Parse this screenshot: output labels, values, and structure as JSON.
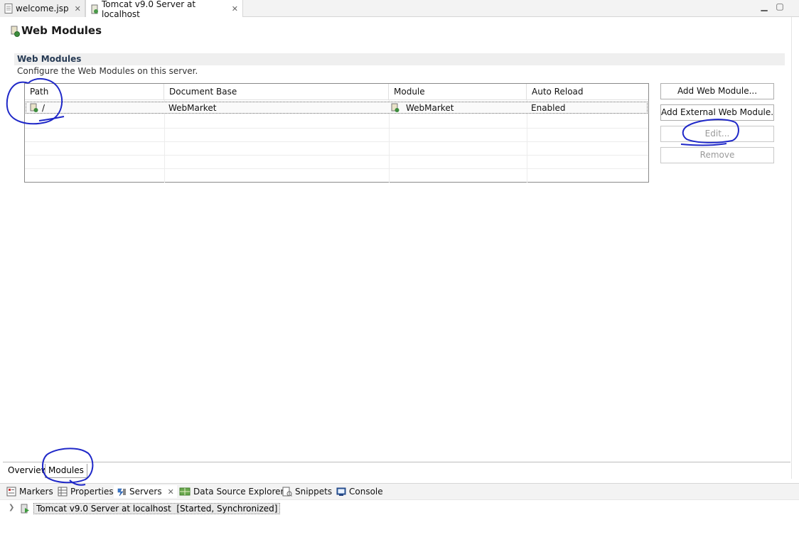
{
  "editor_tabs": [
    {
      "label": "welcome.jsp",
      "icon": "jsp-file-icon"
    },
    {
      "label": "Tomcat v9.0 Server at localhost",
      "icon": "server-config-icon"
    }
  ],
  "page": {
    "title": "Web Modules",
    "section_title": "Web Modules",
    "section_description": "Configure the Web Modules on this server."
  },
  "table": {
    "columns": [
      "Path",
      "Document Base",
      "Module",
      "Auto Reload"
    ],
    "rows": [
      {
        "path": "/",
        "document_base": "WebMarket",
        "module": "WebMarket",
        "auto_reload": "Enabled"
      }
    ]
  },
  "buttons": {
    "add_web_module": "Add Web Module...",
    "add_external_web_module": "Add External Web Module...",
    "edit": "Edit...",
    "remove": "Remove"
  },
  "page_tabs": [
    "Overview",
    "Modules"
  ],
  "views": [
    {
      "label": "Markers",
      "icon": "markers-icon"
    },
    {
      "label": "Properties",
      "icon": "properties-icon"
    },
    {
      "label": "Servers",
      "icon": "servers-icon"
    },
    {
      "label": "Data Source Explorer",
      "icon": "data-source-icon"
    },
    {
      "label": "Snippets",
      "icon": "snippets-icon"
    },
    {
      "label": "Console",
      "icon": "console-icon"
    }
  ],
  "servers": {
    "entry_name": "Tomcat v9.0 Server at localhost",
    "entry_status": "[Started, Synchronized]"
  },
  "colors": {
    "annotation": "#1f28c8",
    "section_header_bg": "#efefef",
    "section_title_text": "#263a54"
  }
}
